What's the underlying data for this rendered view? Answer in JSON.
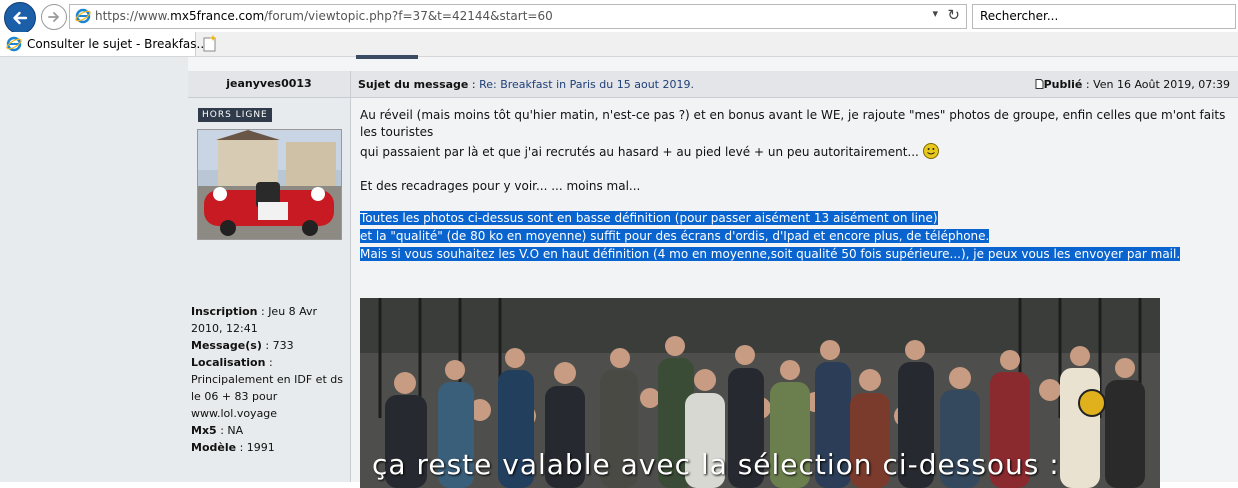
{
  "browser": {
    "url_prefix": "https://www.",
    "url_domain": "mx5france.com",
    "url_path": "/forum/viewtopic.php?f=37&t=42144&start=60",
    "search_placeholder": "Rechercher...",
    "tab_title": "Consulter le sujet - Breakfas..."
  },
  "post": {
    "author": "jeanyves0013",
    "subject_label": "Sujet du message",
    "subject_text": "Re: Breakfast in Paris du 15 aout 2019.",
    "posted_label": "Publié",
    "posted_date": "Ven 16 Août 2019, 07:39",
    "status_badge": "HORS LIGNE",
    "lines": [
      "Au réveil (mais moins tôt qu'hier matin, n'est-ce pas ?) et en bonus avant le WE, je rajoute \"mes\" photos de groupe, enfin celles que m'ont faits",
      "les touristes",
      "qui passaient par là et que j'ai recrutés au hasard + au pied levé + un peu autoritairement...",
      "Et des recadrages pour y voir... ... moins mal..."
    ],
    "selected_lines": [
      "Toutes les photos ci-dessus sont en basse définition (pour passer aisément 13 aisément on line)",
      "et la \"qualité\" (de 80 ko en moyenne) suffit pour des écrans d'ordis, d'Ipad et encore plus, de téléphone.",
      "Mais si vous souhaitez les V.O en haut définition (4 mo en moyenne,soit qualité 50 fois supérieure...), je peux vous les envoyer par mail."
    ],
    "photo_caption": "ça reste valable avec la sélection ci-dessous :"
  },
  "profile": {
    "inscription_label": "Inscription",
    "inscription_value": "Jeu 8 Avr 2010, 12:41",
    "messages_label": "Message(s)",
    "messages_value": "733",
    "localisation_label": "Localisation",
    "localisation_value": "Principalement en IDF et ds le 06 + 83 pour www.lol.voyage",
    "mx5_label": "Mx5",
    "mx5_value": "NA",
    "modele_label": "Modèle",
    "modele_value": "1991"
  },
  "colors": {
    "back_button": "#1c5fa9",
    "selection": "#0a64cf",
    "link": "#1f3f78"
  },
  "icons": [
    "back-arrow-icon",
    "forward-arrow-icon",
    "ie-logo-icon",
    "dropdown-icon",
    "refresh-icon",
    "new-tab-icon",
    "post-icon",
    "smiley-icon"
  ]
}
